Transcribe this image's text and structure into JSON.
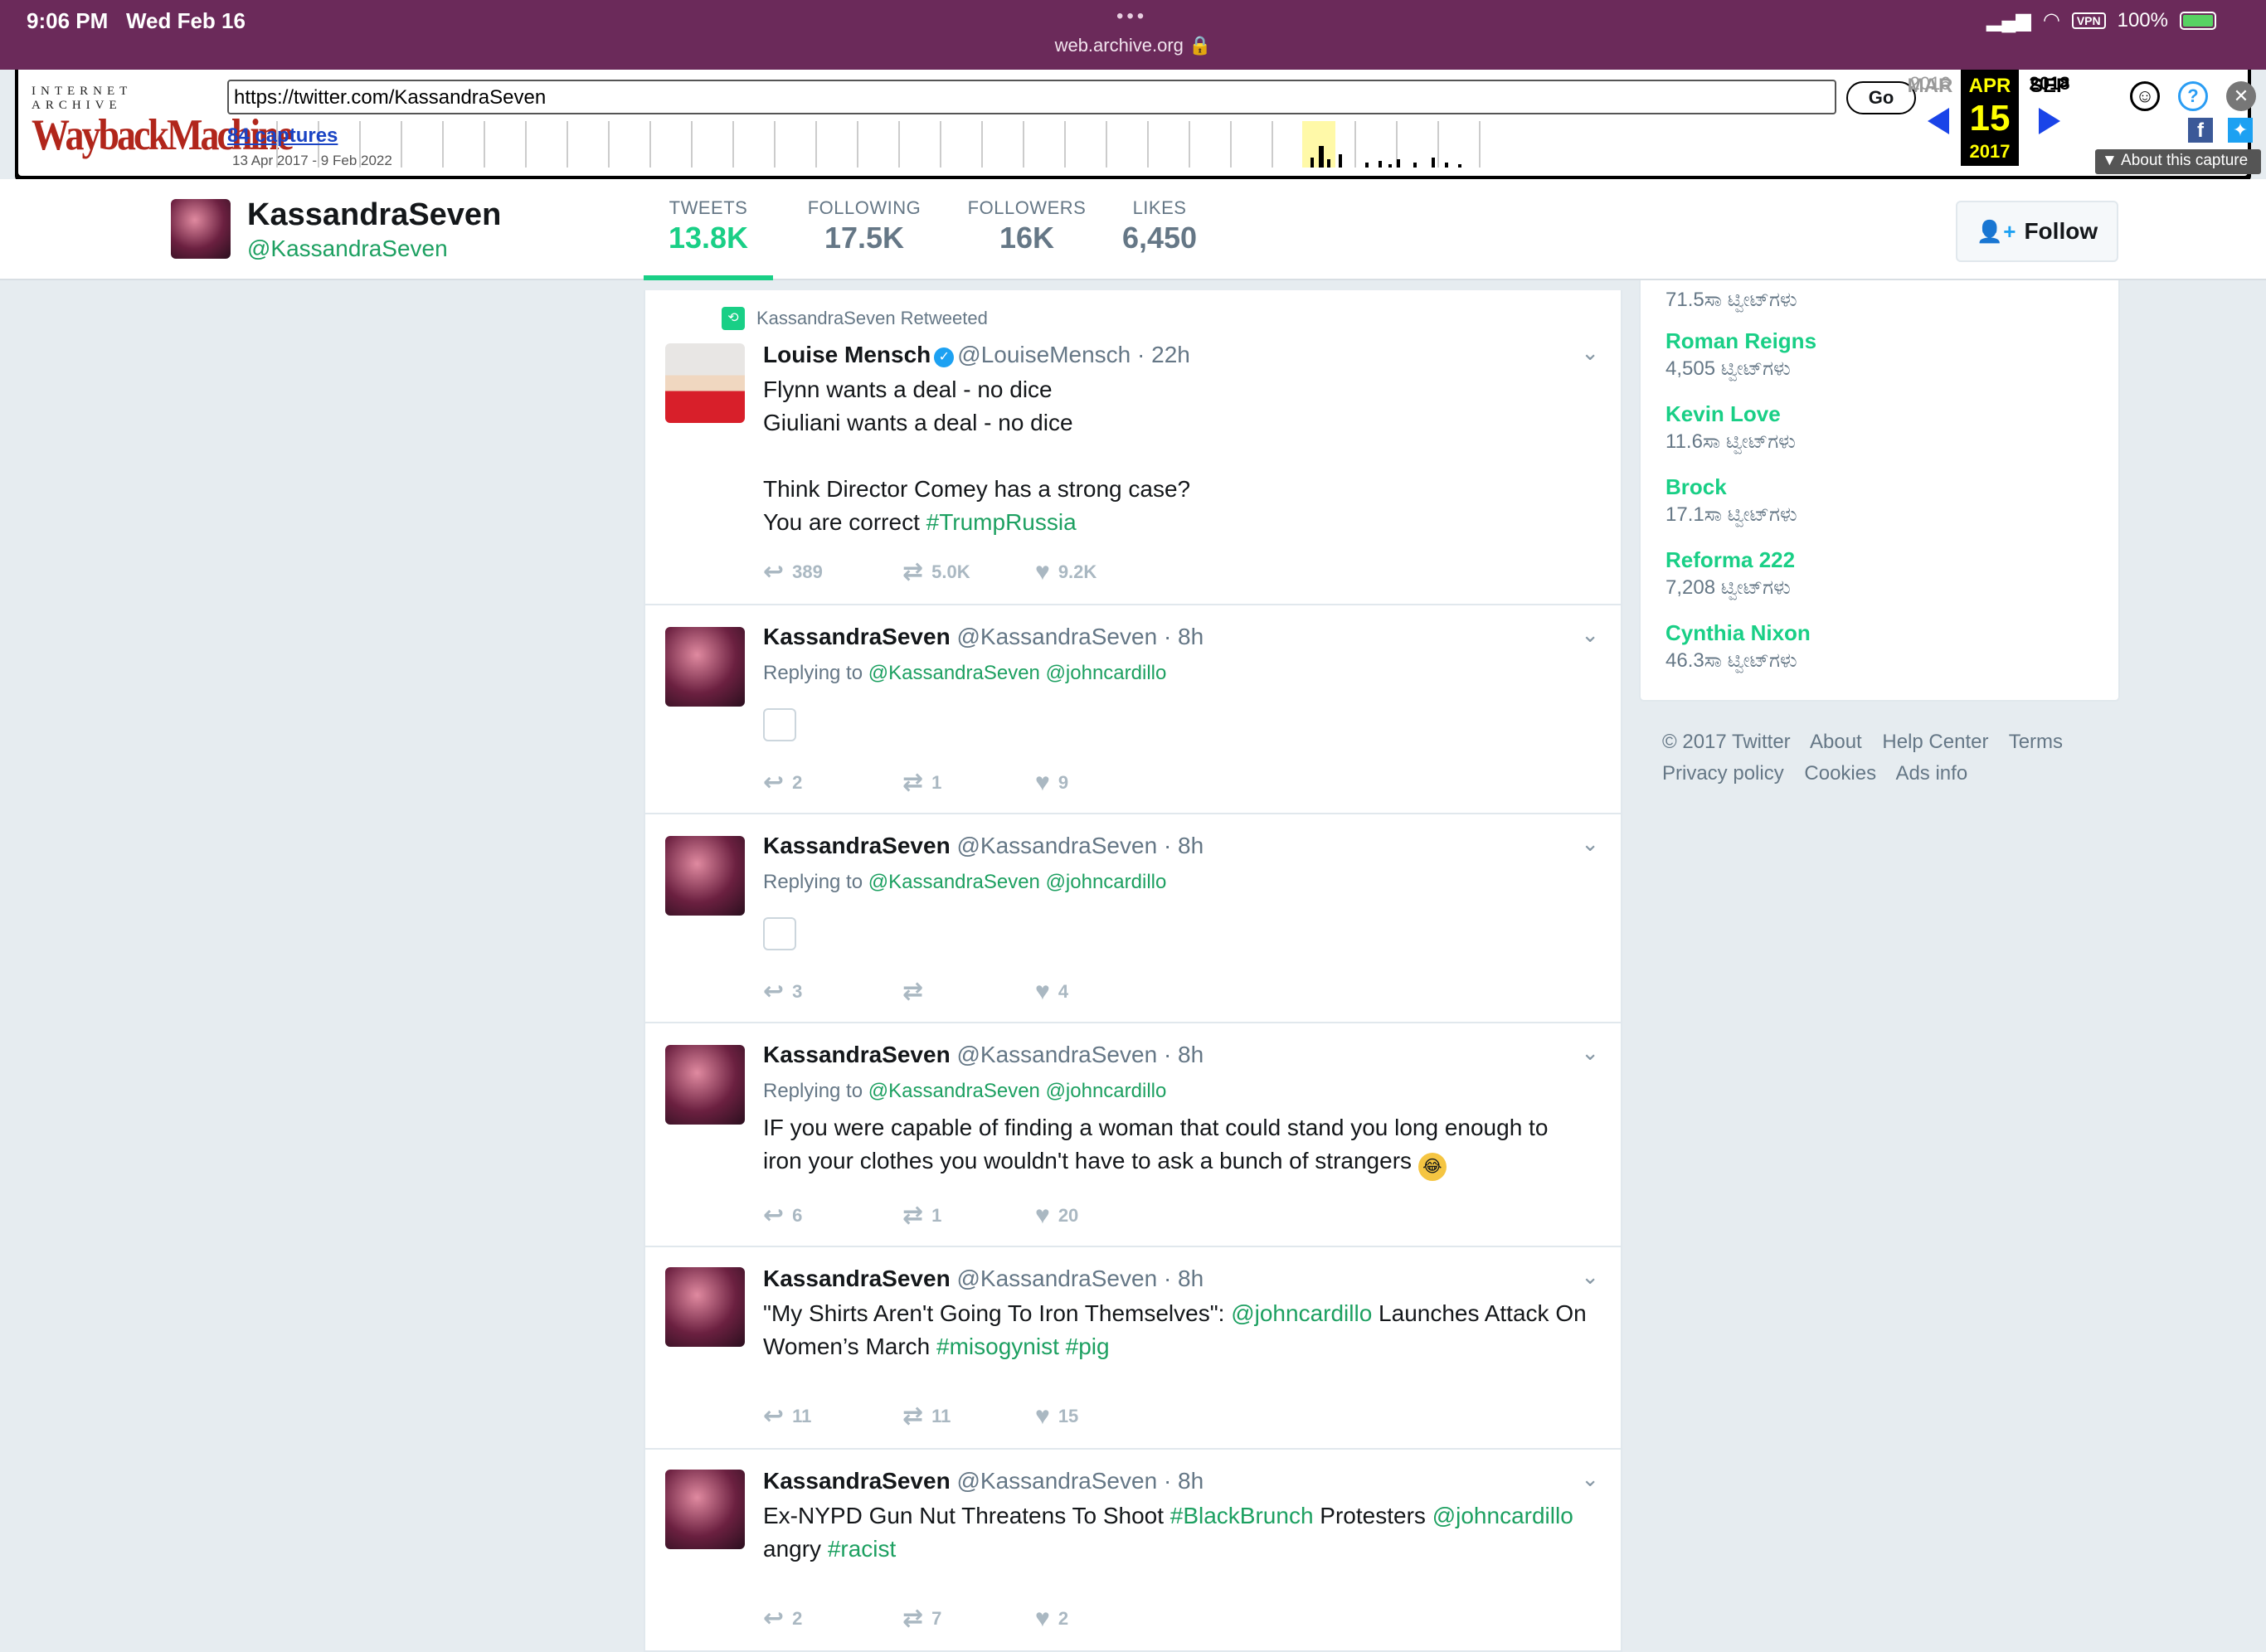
{
  "status_bar": {
    "time": "9:06 PM",
    "date": "Wed Feb 16",
    "url": "web.archive.org",
    "vpn": "VPN",
    "battery": "100%"
  },
  "wayback": {
    "logo_top": "INTERNET ARCHIVE",
    "logo_main": "WaybackMachine",
    "url_value": "https://twitter.com/KassandraSeven",
    "go_label": "Go",
    "captures": "84 captures",
    "range": "13 Apr 2017 - 9 Feb 2022",
    "cal_prev_month": "MAR",
    "cal_prev_year": "2016",
    "cal_cur_month": "APR",
    "cal_cur_day": "15",
    "cal_cur_year": "2017",
    "cal_next_month": "SEP",
    "cal_next_year": "2018",
    "about_label": "▼ About this capture",
    "icons": [
      "user-icon",
      "help-icon",
      "close-icon",
      "facebook-icon",
      "twitter-icon"
    ]
  },
  "profile": {
    "name": "KassandraSeven",
    "handle": "@KassandraSeven",
    "stats": [
      {
        "label": "TWEETS",
        "value": "13.8K"
      },
      {
        "label": "FOLLOWING",
        "value": "17.5K"
      },
      {
        "label": "FOLLOWERS",
        "value": "16K"
      },
      {
        "label": "LIKES",
        "value": "6,450"
      }
    ],
    "follow_label": "Follow"
  },
  "tweets": [
    {
      "retweet_note": "KassandraSeven Retweeted",
      "name": "Louise Mensch",
      "handle": "@LouiseMensch",
      "time": "· 22h",
      "line1": "Flynn wants a deal - no dice",
      "line2": "Giuliani wants a deal - no dice",
      "line3": " Think Director Comey has a strong case?",
      "line4_text": "You are correct ",
      "line4_link": "#TrumpRussia",
      "reply": "389",
      "retweet": "5.0K",
      "like": "9.2K"
    },
    {
      "name": "KassandraSeven",
      "handle": "@KassandraSeven",
      "time": "· 8h",
      "replying": "Replying to",
      "reply_to": "@KassandraSeven @johncardillo",
      "reply": "2",
      "retweet": "1",
      "like": "9"
    },
    {
      "name": "KassandraSeven",
      "handle": "@KassandraSeven",
      "time": "· 8h",
      "replying": "Replying to",
      "reply_to": "@KassandraSeven @johncardillo",
      "reply": "3",
      "retweet": "",
      "like": "4"
    },
    {
      "name": "KassandraSeven",
      "handle": "@KassandraSeven",
      "time": "· 8h",
      "replying": "Replying to",
      "reply_to": "@KassandraSeven @johncardillo",
      "line1": "IF you were capable of finding a woman that could stand you long enough to",
      "line2": "iron your clothes you wouldn't have to ask a bunch of strangers",
      "reply": "6",
      "retweet": "1",
      "like": "20"
    },
    {
      "name": "KassandraSeven",
      "handle": "@KassandraSeven",
      "time": "· 8h",
      "t1": "\"My Shirts Aren't Going To Iron Themselves\": ",
      "t1_link": "@johncardillo",
      "t2": " Launches Attack On",
      "t3": "Women’s March ",
      "t3_link1": "#misogynist",
      "t3_link2": "#pig",
      "reply": "11",
      "retweet": "11",
      "like": "15"
    },
    {
      "name": "KassandraSeven",
      "handle": "@KassandraSeven",
      "time": "· 8h",
      "t1": "Ex-NYPD Gun Nut Threatens To Shoot ",
      "t1_link": "#BlackBrunch",
      "t2": " Protesters ",
      "t2_link": "@johncardillo",
      "t3": "angry ",
      "t3_link": "#racist",
      "reply": "2",
      "retweet": "7",
      "like": "2"
    }
  ],
  "trends": [
    {
      "name": "",
      "count": "71.5ಸಾ ಟ್ವೀಟ್‌ಗಳು"
    },
    {
      "name": "Roman Reigns",
      "count": "4,505 ಟ್ವೀಟ್‌ಗಳು"
    },
    {
      "name": "Kevin Love",
      "count": "11.6ಸಾ ಟ್ವೀಟ್‌ಗಳು"
    },
    {
      "name": "Brock",
      "count": "17.1ಸಾ ಟ್ವೀಟ್‌ಗಳು"
    },
    {
      "name": "Reforma 222",
      "count": "7,208 ಟ್ವೀಟ್‌ಗಳು"
    },
    {
      "name": "Cynthia Nixon",
      "count": "46.3ಸಾ ಟ್ವೀಟ್‌ಗಳು"
    }
  ],
  "footer": {
    "copyright": "© 2017 Twitter",
    "about": "About",
    "help": "Help Center",
    "terms": "Terms",
    "privacy": "Privacy policy",
    "cookies": "Cookies",
    "ads": "Ads info"
  },
  "colors": {
    "accent": "#19cf86",
    "link": "#1da061",
    "safari_bar": "#6b2a5a"
  }
}
